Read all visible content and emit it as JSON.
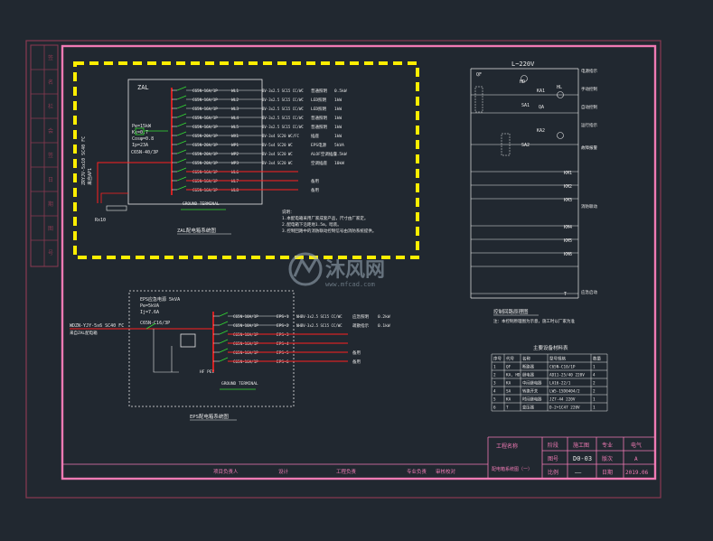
{
  "colors": {
    "background": "#212830",
    "outer_frame": "#8a3a52",
    "sheet_border": "#f07ab4",
    "yellow_box": "#ffee00",
    "white": "#e8e8e8",
    "red": "#ff2020",
    "green": "#33dd33",
    "cyan": "#33cccc"
  },
  "panel_zal": {
    "name": "ZAL",
    "caption": "ZAL配电箱系统图",
    "params": [
      "Pe=15kW",
      "Kx=0.7",
      "Cosφ=0.8",
      "Ip=23A"
    ],
    "main_breaker": "C65N-40/3P",
    "incoming_cable": "ZRYJV-5x10 SC40 FC",
    "incoming_tag": "来自AP1",
    "ground": "Rx10",
    "ground_bar": "GROUND TERMINAL",
    "circuits": [
      {
        "breaker": "C65N-16A/1P",
        "no": "WL1",
        "cable": "BV-3x2.5 SC15 CC/WC",
        "load": "普通照明",
        "kw": "0.5kW"
      },
      {
        "breaker": "C65N-16A/1P",
        "no": "WL2",
        "cable": "BV-3x2.5 SC15 CC/WC",
        "load": "LED照明",
        "kw": "1kW"
      },
      {
        "breaker": "C65N-16A/1P",
        "no": "WL3",
        "cable": "BV-3x2.5 SC15 CC/WC",
        "load": "LED照明",
        "kw": "1kW"
      },
      {
        "breaker": "C65N-16A/1P",
        "no": "WL4",
        "cable": "BV-3x2.5 SC15 CC/WC",
        "load": "普通照明",
        "kw": "1kW"
      },
      {
        "breaker": "C65N-16A/1P",
        "no": "WL5",
        "cable": "BV-3x2.5 SC15 CC/WC",
        "load": "普通照明",
        "kw": "1kW"
      },
      {
        "breaker": "C65N-20A/1P",
        "no": "WX1",
        "cable": "BV-3x4 SC20 WC/FC",
        "load": "插座",
        "kw": "1kW"
      },
      {
        "breaker": "C65N-20A/1P",
        "no": "WP1",
        "cable": "BV-5x4 SC20 WC",
        "load": "EPS电源",
        "kw": "5kVA"
      },
      {
        "breaker": "C65N-20A/1P",
        "no": "WP2",
        "cable": "BV-3x4 SC20 WC",
        "load": "ALOF空调插座",
        "kw": "2.5kW"
      },
      {
        "breaker": "C65N-20A/1P",
        "no": "WP3",
        "cable": "BV-3x4 SC20 WC",
        "load": "空调插座",
        "kw": "10kW"
      },
      {
        "breaker": "C65N-16A/1P",
        "no": "WL6",
        "cable": "",
        "load": "",
        "kw": ""
      },
      {
        "breaker": "C65N-16A/1P",
        "no": "WL7",
        "cable": "",
        "load": "备用",
        "kw": ""
      },
      {
        "breaker": "C65N-16A/1P",
        "no": "WL8",
        "cable": "",
        "load": "备用",
        "kw": ""
      }
    ],
    "notes": [
      "说明：",
      "1.本配电箱采用厂家成套产品，尺寸由厂家定。",
      "2.配电箱下沿距地1.5m，暗装。",
      "3.控制回路中的消防联动控制信号由消防系统提供。"
    ]
  },
  "panel_eps": {
    "name": "EPS",
    "caption": "EPS配电箱系统图",
    "params": [
      "EPS应急电源 5kVA",
      "Pe=5kVA",
      "Ij=7.6A"
    ],
    "main_breaker": "C65N-C16/3P",
    "incoming_cable": "WDZN-YJY-5x6 SC40 FC",
    "incoming_tag": "来自ZAL配电箱",
    "ground_bar": "GROUND TERMINAL",
    "circuits": [
      {
        "breaker": "C65N-10A/1P",
        "no": "EPS-1",
        "cable": "NHBV-3x2.5 SC15 CC/WC",
        "load": "应急照明",
        "kw": "0.2kW"
      },
      {
        "breaker": "C65N-10A/1P",
        "no": "EPS-2",
        "cable": "NHBV-3x2.5 SC15 CC/WC",
        "load": "疏散指示",
        "kw": "0.1kW"
      },
      {
        "breaker": "C65N-10A/1P",
        "no": "EPS-3",
        "cable": "",
        "load": "",
        "kw": ""
      },
      {
        "breaker": "C65N-16A/1P",
        "no": "EPS-4",
        "cable": "",
        "load": "",
        "kw": ""
      },
      {
        "breaker": "C65N-16A/1P",
        "no": "EPS-5",
        "cable": "",
        "load": "备用",
        "kw": ""
      },
      {
        "breaker": "C65N-16A/1P",
        "no": "EPS-6",
        "cable": "",
        "load": "备用",
        "kw": ""
      }
    ],
    "device": "HF\nPEV"
  },
  "control_circuit": {
    "title": "L~220V",
    "caption": "控制回路原理图",
    "caption_note": "注：本控制原理图为示意，施工时以厂家为准",
    "labels": [
      "QF",
      "HD",
      "KA1",
      "KA2",
      "HL",
      "SA1",
      "SA2",
      "QA",
      "KM1",
      "KM2",
      "KM3",
      "KM4",
      "KM5",
      "KM6",
      "T"
    ],
    "right_notes": [
      "电源指示",
      "手动控制",
      "自动控制",
      "运行指示",
      "故障报警",
      "消防联动",
      "应急启动"
    ]
  },
  "materials_table": {
    "title": "主要设备材料表",
    "headers": [
      "序号",
      "代号",
      "名称",
      "型号规格",
      "数量"
    ],
    "rows": [
      [
        "1",
        "QF",
        "断路器",
        "C65N-C10/1P",
        "1"
      ],
      [
        "2",
        "KA, HD",
        "继电器",
        "AD11-25/40  220V",
        "4"
      ],
      [
        "3",
        "KA",
        "中间继电器",
        "LA16-22/1",
        "2"
      ],
      [
        "4",
        "SA",
        "转换开关",
        "LW5-15D0404/2",
        "2"
      ],
      [
        "5",
        "KA",
        "时间继电器",
        "JZ7-44 220V",
        "1"
      ],
      [
        "6",
        "T",
        "变压器",
        "D-2+1C47 220V",
        "1"
      ]
    ]
  },
  "title_block": {
    "project_label": "工程名称",
    "stage_label": "阶段",
    "stage_value": "施工图",
    "prof_label": "专业",
    "prof_value": "电气",
    "drawing_no_label": "图号",
    "drawing_no": "D0-03",
    "version_label": "版次",
    "version_value": "A",
    "scale_label": "比例",
    "scale_value": "——",
    "date_label": "日期",
    "date_value": "2019.06",
    "drawing_name": "配电箱系统图（一）",
    "bottom_row": [
      "项目负责人",
      "设计",
      "工程负责",
      "专业负责",
      "审核校对"
    ]
  },
  "left_strip": [
    "签",
    "名",
    "栏",
    "会",
    "签",
    "日",
    "期",
    "图",
    "号"
  ],
  "watermark": {
    "brand": "沐风网",
    "url": "www.mfcad.com"
  }
}
